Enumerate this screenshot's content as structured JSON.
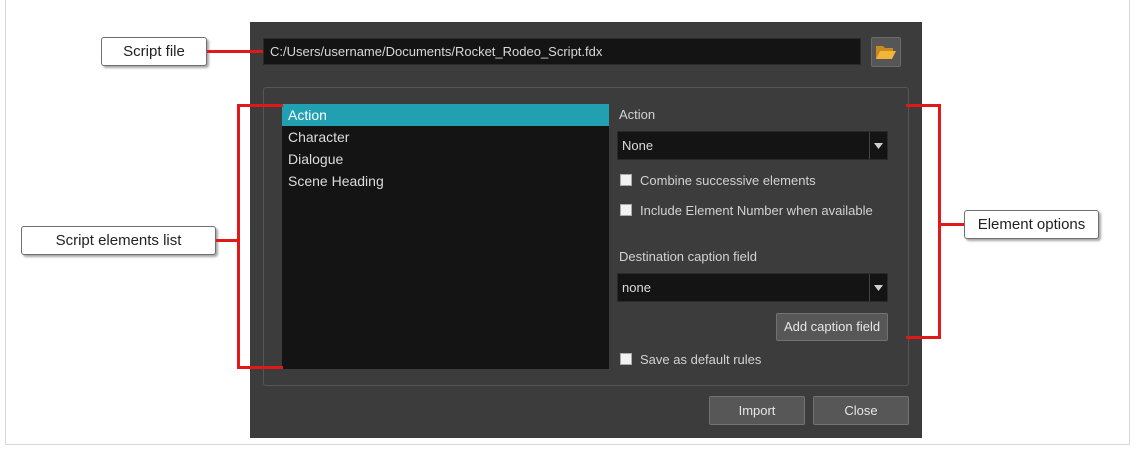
{
  "script_file": {
    "path": "C:/Users/username/Documents/Rocket_Rodeo_Script.fdx",
    "browse_icon": "open-folder-icon"
  },
  "elements_list": {
    "items": [
      "Action",
      "Character",
      "Dialogue",
      "Scene Heading"
    ],
    "selected": "Action"
  },
  "options": {
    "section_title": "Action",
    "action_value": "None",
    "combine_label": "Combine successive elements",
    "include_number_label": "Include Element Number when available",
    "destination_label": "Destination caption field",
    "destination_value": "none",
    "add_caption_label": "Add caption field",
    "save_default_label": "Save as default rules"
  },
  "buttons": {
    "import": "Import",
    "close": "Close"
  },
  "callouts": {
    "script_file": "Script file",
    "elements_list": "Script elements list",
    "element_options": "Element options"
  },
  "colors": {
    "dialog_bg": "#3c3c3c",
    "field_bg": "#141414",
    "selection": "#21a0b2",
    "annotation_red": "#e01818"
  }
}
